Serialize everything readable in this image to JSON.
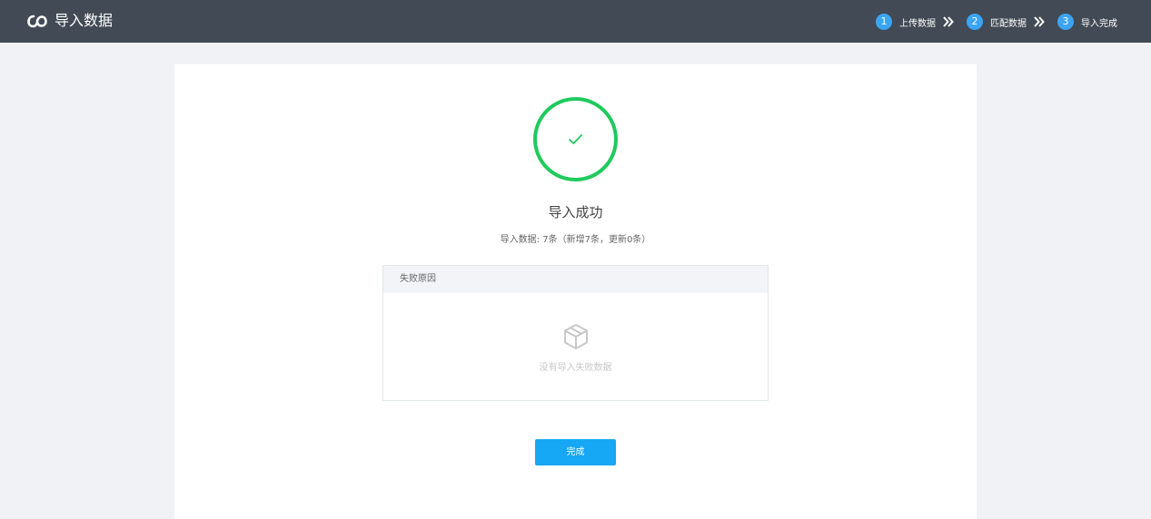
{
  "header": {
    "title": "导入数据",
    "logo_icon": "cloud-link-icon",
    "steps": [
      {
        "number": "1",
        "label": "上传数据"
      },
      {
        "number": "2",
        "label": "匹配数据"
      },
      {
        "number": "3",
        "label": "导入完成"
      }
    ],
    "step_separator_icon": "double-chevron-right-icon",
    "step_color": "#3ba4f4",
    "background": "#414a55"
  },
  "result": {
    "icon": "check-circle-icon",
    "title": "导入成功",
    "detail": "导入数据: 7条（新增7条，更新0条）",
    "color": "#1fca5c"
  },
  "failure_panel": {
    "header": "失败原因",
    "empty_icon": "empty-box-icon",
    "empty_text": "没有导入失败数据"
  },
  "actions": {
    "done_label": "完成",
    "done_color": "#16a7f5"
  }
}
